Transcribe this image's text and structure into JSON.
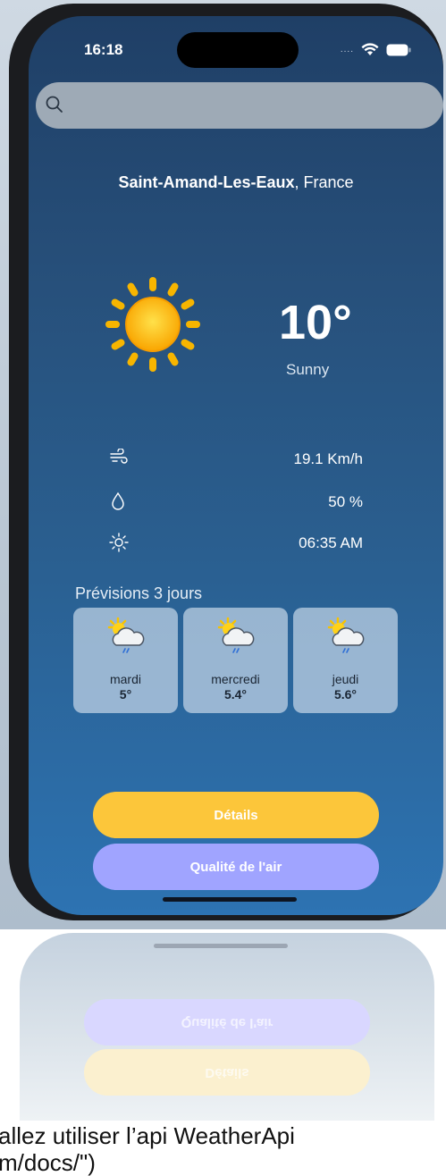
{
  "status_bar": {
    "time": "16:18"
  },
  "search": {
    "placeholder": "",
    "value": ""
  },
  "location": {
    "city": "Saint-Amand-Les-Eaux",
    "country": ", France"
  },
  "current": {
    "temperature": "10°",
    "condition": "Sunny",
    "icon": "sun-icon"
  },
  "metrics": [
    {
      "icon": "wind-icon",
      "value": "19.1 Km/h"
    },
    {
      "icon": "humidity-drop-icon",
      "value": "50 %"
    },
    {
      "icon": "sunrise-icon",
      "value": "06:35 AM"
    }
  ],
  "forecast": {
    "title": "Prévisions 3 jours",
    "days": [
      {
        "day": "mardi",
        "temp": "5°",
        "icon": "partly-cloudy-rain-icon"
      },
      {
        "day": "mercredi",
        "temp": "5.4°",
        "icon": "partly-cloudy-rain-icon"
      },
      {
        "day": "jeudi",
        "temp": "5.6°",
        "icon": "partly-cloudy-rain-icon"
      }
    ]
  },
  "buttons": {
    "details": "Détails",
    "air_quality": "Qualité de l'air"
  },
  "reflection": {
    "air_quality": "Qualité de l'air",
    "details": "Détails"
  },
  "bottom_text": {
    "line1": "allez utiliser l’api WeatherApi",
    "line2": "m/docs/\")"
  },
  "colors": {
    "details_button": "#fcc63a",
    "air_button": "#a0a4ff",
    "screen_top": "#1f3f66",
    "screen_bottom": "#2d73b2"
  }
}
